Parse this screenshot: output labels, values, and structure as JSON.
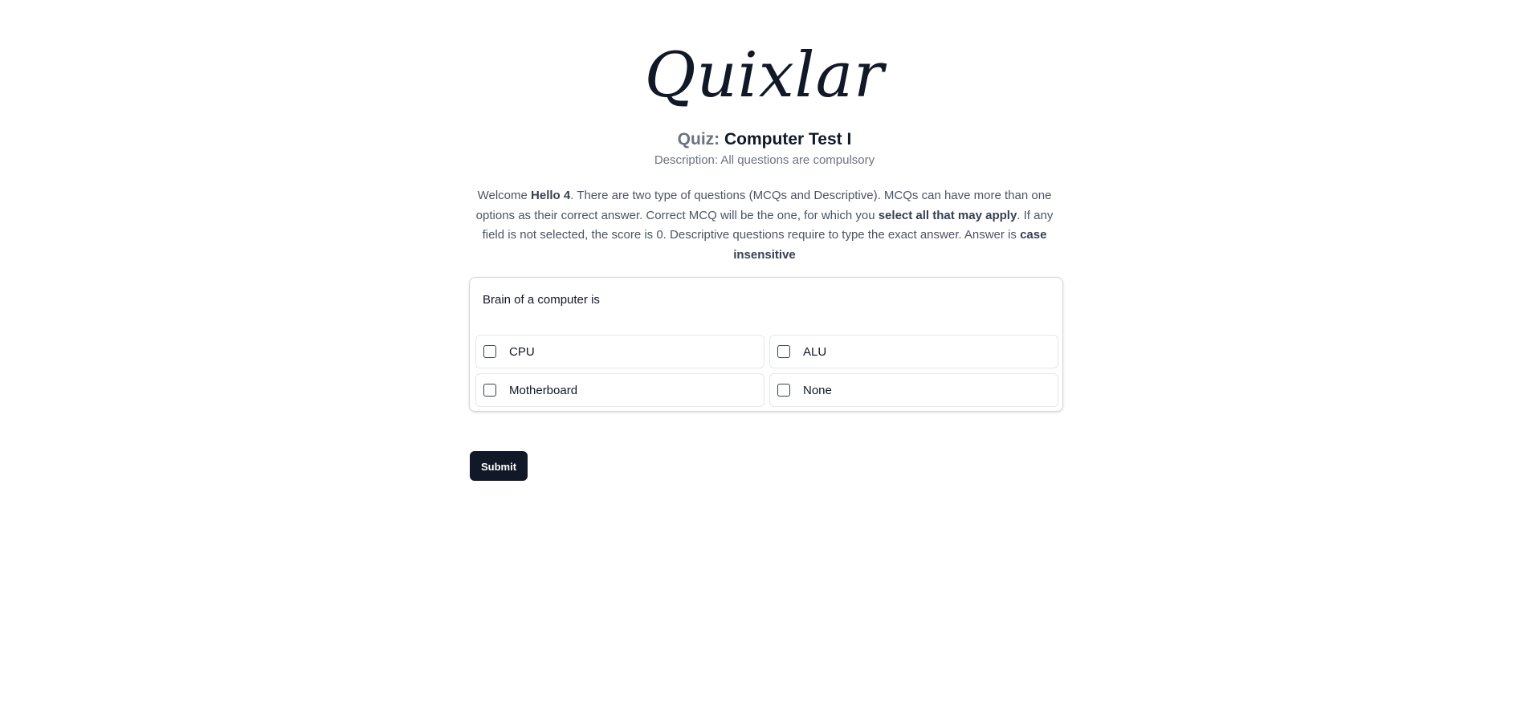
{
  "header": {
    "logo_text": "Quixlar",
    "quiz_prefix": "Quiz:",
    "quiz_name": "Computer Test I",
    "description": "Description: All questions are compulsory"
  },
  "instructions": {
    "welcome": "Welcome ",
    "user_name": "Hello 4",
    "part1": ". There are two type of questions (MCQs and Descriptive). MCQs can have more than one options as their correct answer. Correct MCQ will be the one, for which you ",
    "emphasis1": "select all that may apply",
    "part2": ". If any field is not selected, the score is 0. Descriptive questions require to type the exact answer. Answer is ",
    "emphasis2": "case insensitive"
  },
  "question": {
    "text": "Brain of a computer is",
    "options": [
      {
        "label": "CPU",
        "checked": false
      },
      {
        "label": "ALU",
        "checked": false
      },
      {
        "label": "Motherboard",
        "checked": false
      },
      {
        "label": "None",
        "checked": false
      }
    ]
  },
  "actions": {
    "submit_label": "Submit"
  }
}
